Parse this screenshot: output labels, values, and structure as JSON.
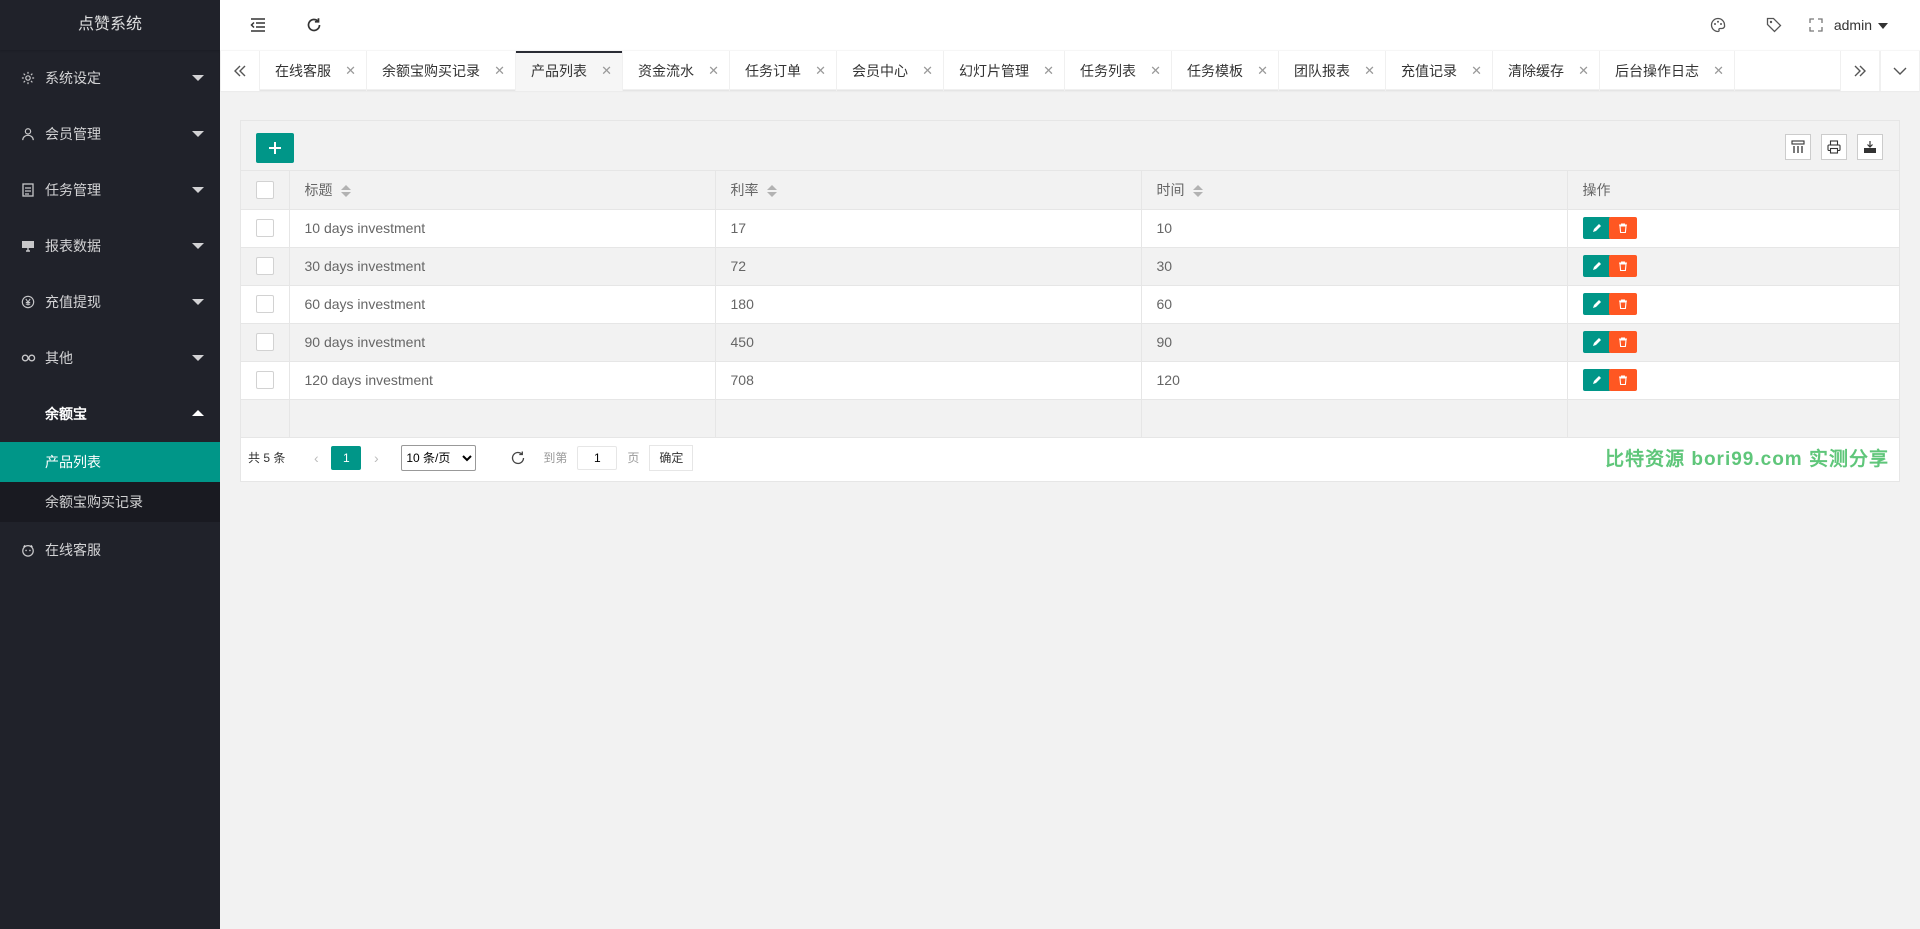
{
  "app": {
    "title": "点赞系统"
  },
  "sidebar": {
    "items": [
      {
        "label": "系统设定",
        "icon": "gear-icon"
      },
      {
        "label": "会员管理",
        "icon": "user-icon"
      },
      {
        "label": "任务管理",
        "icon": "document-icon"
      },
      {
        "label": "报表数据",
        "icon": "monitor-icon"
      },
      {
        "label": "充值提现",
        "icon": "yen-icon"
      },
      {
        "label": "其他",
        "icon": "link-icon"
      },
      {
        "label": "余额宝",
        "icon": "",
        "expanded": true,
        "children": [
          {
            "label": "产品列表",
            "active": true
          },
          {
            "label": "余额宝购买记录"
          }
        ]
      },
      {
        "label": "在线客服",
        "icon": "face-icon"
      }
    ]
  },
  "header": {
    "user": "admin"
  },
  "tabs": [
    {
      "label": "在线客服"
    },
    {
      "label": "余额宝购买记录"
    },
    {
      "label": "产品列表",
      "active": true
    },
    {
      "label": "资金流水"
    },
    {
      "label": "任务订单"
    },
    {
      "label": "会员中心"
    },
    {
      "label": "幻灯片管理"
    },
    {
      "label": "任务列表"
    },
    {
      "label": "任务模板"
    },
    {
      "label": "团队报表"
    },
    {
      "label": "充值记录"
    },
    {
      "label": "清除缓存"
    },
    {
      "label": "后台操作日志"
    }
  ],
  "table": {
    "columns": [
      "标题",
      "利率",
      "时间",
      "操作"
    ],
    "rows": [
      {
        "title": "10 days investment",
        "rate": "17",
        "time": "10"
      },
      {
        "title": "30 days investment",
        "rate": "72",
        "time": "30"
      },
      {
        "title": "60 days investment",
        "rate": "180",
        "time": "60"
      },
      {
        "title": "90 days investment",
        "rate": "450",
        "time": "90"
      },
      {
        "title": "120 days investment",
        "rate": "708",
        "time": "120"
      }
    ]
  },
  "pager": {
    "count_text": "共 5 条",
    "current_page": "1",
    "page_size_option": "10 条/页",
    "goto_label": "到第",
    "goto_value": "1",
    "page_label": "页",
    "confirm_label": "确定"
  },
  "watermark": "比特资源 bori99.com 实测分享",
  "colors": {
    "primary": "#009688",
    "danger": "#ff5722",
    "sidebar_bg": "#20222a"
  }
}
